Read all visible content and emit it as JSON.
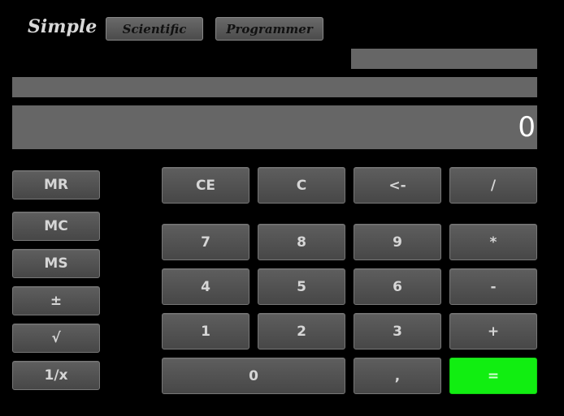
{
  "mode_bar": {
    "current": "Simple",
    "scientific_label": "Scientific",
    "programmer_label": "Programmer"
  },
  "display": {
    "value": "0",
    "bar_color": "#666666"
  },
  "memory_keys": [
    "MR",
    "MC",
    "MS",
    "±",
    "√",
    "1/x"
  ],
  "keypad": {
    "ce": "CE",
    "c": "C",
    "backspace": "<-",
    "divide": "/",
    "seven": "7",
    "eight": "8",
    "nine": "9",
    "multiply": "*",
    "four": "4",
    "five": "5",
    "six": "6",
    "minus": "-",
    "one": "1",
    "two": "2",
    "three": "3",
    "plus": "+",
    "zero": "0",
    "decimal": ",",
    "equals": "="
  },
  "colors": {
    "background": "#000000",
    "key": "#555555",
    "equals_key": "#11ee11"
  }
}
